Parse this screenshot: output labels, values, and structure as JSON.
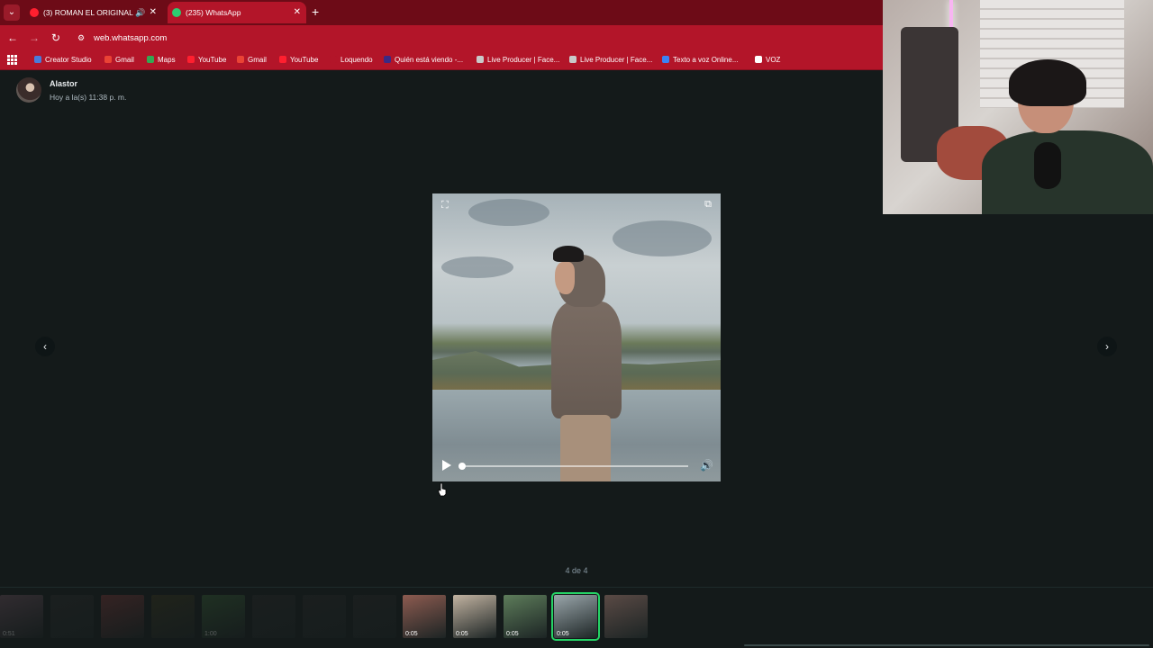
{
  "browser": {
    "tabs": [
      {
        "title": "(3) ROMAN EL ORIGINAL /",
        "active": false,
        "audio": true
      },
      {
        "title": "(235) WhatsApp",
        "active": true,
        "audio": false
      }
    ],
    "new_tab": "+",
    "url": "web.whatsapp.com",
    "bookmarks": [
      {
        "label": "Creator Studio",
        "color": "#4a7bd9"
      },
      {
        "label": "Gmail",
        "color": "#ea4335"
      },
      {
        "label": "Maps",
        "color": "#34a853"
      },
      {
        "label": "YouTube",
        "color": "#ff1f2f"
      },
      {
        "label": "Gmail",
        "color": "#ea4335"
      },
      {
        "label": "YouTube",
        "color": "#ff1f2f"
      },
      {
        "label": "Loquendo",
        "color": "#b31529"
      },
      {
        "label": "Quién está viendo -...",
        "color": "#3b2a84"
      },
      {
        "label": "Live Producer | Face...",
        "color": "#c9c9c9"
      },
      {
        "label": "Live Producer | Face...",
        "color": "#c9c9c9"
      },
      {
        "label": "Texto a voz Online...",
        "color": "#3b82f6"
      },
      {
        "label": "VOZ",
        "color": "#ffffff"
      }
    ]
  },
  "viewer": {
    "sender_name": "Alastor",
    "sent_time": "Hoy a la(s) 11:38 p. m.",
    "counter": "4 de 4",
    "playback_progress": 0.0
  },
  "thumbnails": [
    {
      "duration": "0:51",
      "dim": true,
      "color": "#7d5b6a"
    },
    {
      "duration": "",
      "dim": true,
      "color": "#2d2d2d"
    },
    {
      "duration": "",
      "dim": true,
      "color": "#8a3a3a"
    },
    {
      "duration": "",
      "dim": true,
      "color": "#3f3a1c"
    },
    {
      "duration": "1:00",
      "dim": true,
      "color": "#3e6a3a"
    },
    {
      "duration": "",
      "dim": true,
      "color": "#2b2b2b"
    },
    {
      "duration": "",
      "dim": true,
      "color": "#2b2b2b"
    },
    {
      "duration": "",
      "dim": true,
      "color": "#2b2b2b"
    },
    {
      "duration": "0:05",
      "dim": false,
      "color": "#8d5b50"
    },
    {
      "duration": "0:05",
      "dim": false,
      "color": "#c2b3a1"
    },
    {
      "duration": "0:05",
      "dim": false,
      "color": "#5d7c5a"
    },
    {
      "duration": "0:05",
      "dim": false,
      "color": "#9aa6ab",
      "active": true
    },
    {
      "duration": "",
      "dim": false,
      "color": "#5a4a45"
    }
  ]
}
